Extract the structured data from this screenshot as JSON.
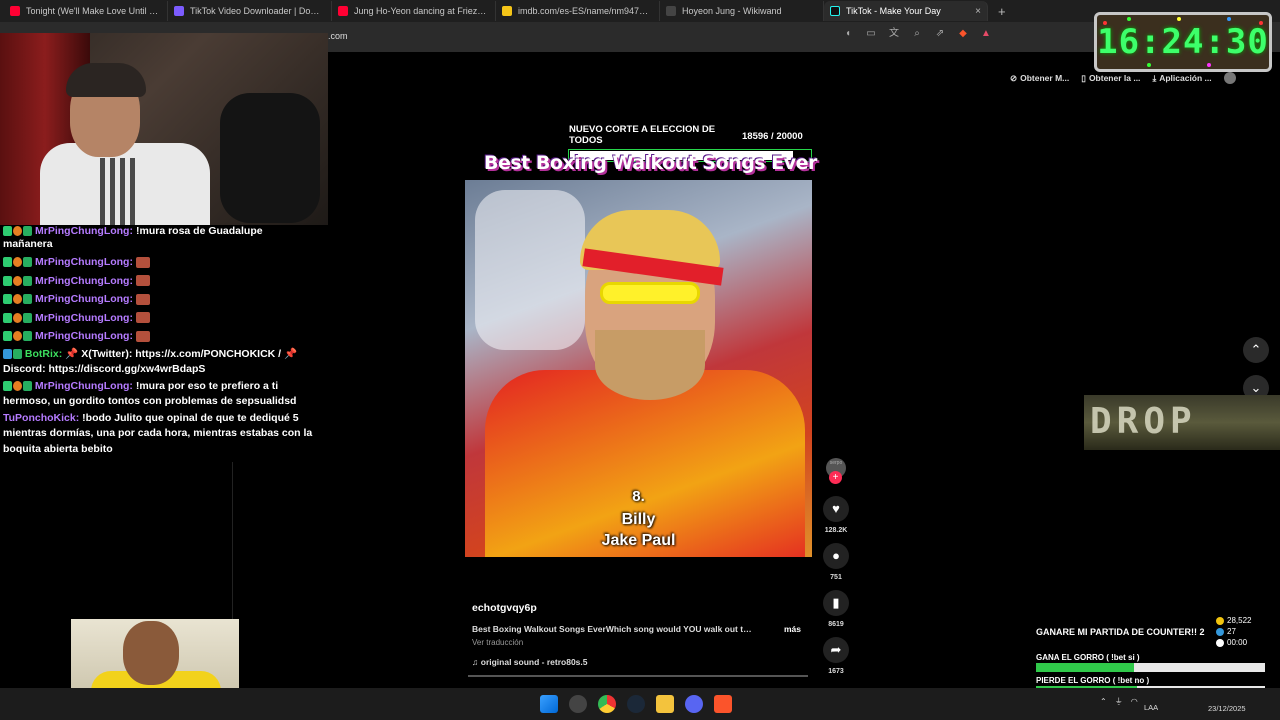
{
  "browser": {
    "tabs": [
      {
        "title": "Tonight (We'll Make Love Until We D",
        "color": "#ff0033"
      },
      {
        "title": "TikTok Video Downloader | Downloa",
        "color": "#7c5cff"
      },
      {
        "title": "Jung Ho-Yeon dancing at Frieze Seo",
        "color": "#ff0033"
      },
      {
        "title": "imdb.com/es-ES/name/nm9475707/",
        "color": "#f5c518"
      },
      {
        "title": "Hoyeon Jung - Wikiwand",
        "color": "#444444"
      },
      {
        "title": "TikTok - Make Your Day",
        "color": "#111111"
      }
    ],
    "new_tab": "+",
    "close": "×",
    "url": ".com",
    "bookmarks": [
      "Obtener M...",
      "Obtener la ...",
      "Aplicación ..."
    ]
  },
  "clock": "16:24:30",
  "chat": {
    "lines": [
      {
        "user": "MrPingChungLong:",
        "msg": "!mura rosa de Guadalupe",
        "color": "purple"
      },
      {
        "user": "",
        "msg": "mañanera",
        "color": "none"
      },
      {
        "user": "MrPingChungLong:",
        "msg": "",
        "color": "purple",
        "emote": true
      },
      {
        "user": "MrPingChungLong:",
        "msg": "",
        "color": "purple",
        "emote": true
      },
      {
        "user": "MrPingChungLong:",
        "msg": "",
        "color": "purple",
        "emote": true
      },
      {
        "user": "MrPingChungLong:",
        "msg": "",
        "color": "purple",
        "emote": true
      },
      {
        "user": "MrPingChungLong:",
        "msg": "",
        "color": "purple",
        "emote": true
      }
    ],
    "botrix_user": "BotRix:",
    "botrix_msg": "X(Twitter): https://x.com/PONCHOKICK /",
    "botrix_msg2": "Discord: https://discord.gg/xw4wrBdapS",
    "msg_a_user": "MrPingChungLong:",
    "msg_a_text": "!mura por eso te prefiero a ti hermoso, un gordito tontos con problemas de sepsualidsd",
    "msg_b_user": "TuPonchoKick:",
    "msg_b_text": "!bodo Julito que opinal de que te dediqué 5 mientras dormías, una por cada hora, mientras estabas con la boquita abierta bebito"
  },
  "overlay": {
    "title": "NUEVO CORTE A ELECCION DE TODOS",
    "count": "18596   / 20000",
    "progress": 0.93
  },
  "video": {
    "title": "Best Boxing Walkout Songs Ever",
    "caption_number": "8.",
    "caption_name1": "Billy",
    "caption_name2": "Jake Paul",
    "likes": "128.2K",
    "comments": "751",
    "saves": "8619",
    "shares": "1673",
    "username": "echotgvqy6p",
    "description": "Best Boxing Walkout Songs EverWhich song would YOU walk out to?...",
    "more": "más",
    "translate": "Ver traducción",
    "sound": "original sound - retro80s.5"
  },
  "nav": {
    "up": "⌃",
    "down": "⌄"
  },
  "drop_banner": "DROP",
  "prediction": {
    "title": "GANARE MI PARTIDA DE COUNTER!! 2",
    "points": "28,522",
    "users": "27",
    "timer": "00:00",
    "option1": "GANA EL GORRO ( !bet si )",
    "option1_fill": 0.43,
    "option2": "PIERDE EL GORRO ( !bet no )",
    "option2_fill": 0.44
  },
  "taskbar": {
    "lang": "LAA",
    "date": "23/12/2025"
  },
  "colors": {
    "chat_purple": "#b57bff",
    "chat_green": "#3cdf5e",
    "clock_green": "#3dff6a",
    "progress_border": "#26d64b",
    "bar_green": "#30c94a"
  }
}
